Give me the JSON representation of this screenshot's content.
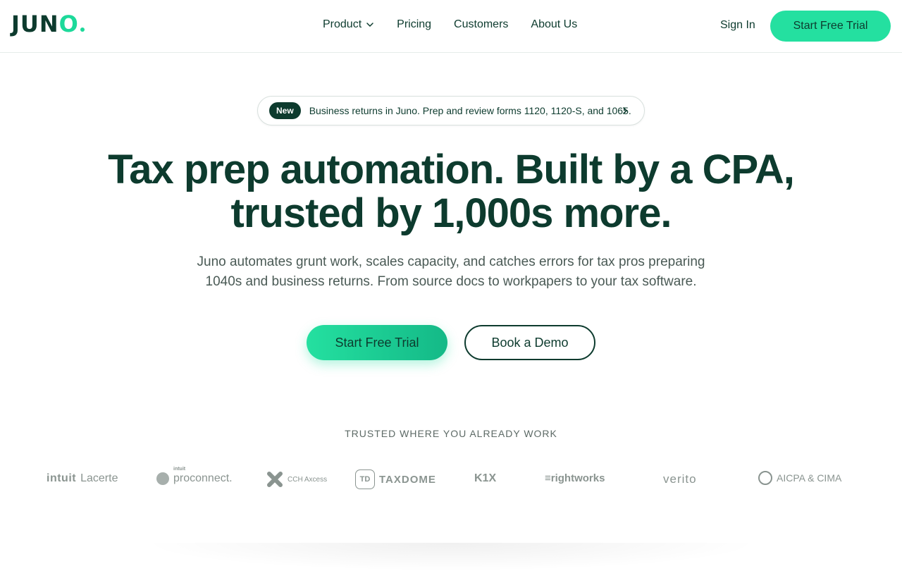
{
  "nav": {
    "logo": "JUNO",
    "links": [
      {
        "label": "Product",
        "has_dropdown": true
      },
      {
        "label": "Pricing"
      },
      {
        "label": "Customers"
      },
      {
        "label": "About Us"
      }
    ],
    "sign_in": "Sign In",
    "cta": "Start Free Trial"
  },
  "announcement": {
    "badge": "New",
    "text": "Business returns in Juno. Prep and review forms 1120, 1120-S, and 1065."
  },
  "hero": {
    "headline_line1": "Tax prep automation. Built by a CPA,",
    "headline_line2": "trusted by 1,000s more.",
    "subtitle_line1": "Juno automates grunt work, scales capacity, and catches errors for tax pros preparing",
    "subtitle_line2": "1040s and business returns. From source docs to workpapers to your tax software.",
    "primary_cta": "Start Free Trial",
    "secondary_cta": "Book a Demo"
  },
  "trust": {
    "heading": "TRUSTED WHERE YOU ALREADY WORK",
    "logos": [
      {
        "name": "intuit-lacerte",
        "text_a": "intuit",
        "text_b": "Lacerte"
      },
      {
        "name": "proconnect",
        "text_a": "intuit",
        "text_b": "proconnect."
      },
      {
        "name": "cch-axcess",
        "text_b": "CCH Axcess"
      },
      {
        "name": "taxdome",
        "text_a": "TD",
        "text_b": "TAXDOME"
      },
      {
        "name": "k1x",
        "text_b": "K1X"
      },
      {
        "name": "rightworks",
        "text_b": "≡rightworks"
      },
      {
        "name": "verito",
        "text_b": "verito"
      },
      {
        "name": "aicpa-cima",
        "text_b": "AICPA & CIMA"
      }
    ]
  },
  "colors": {
    "brand_dark": "#0d3b2e",
    "brand_accent": "#24e0a0",
    "muted_text": "#4a5a55",
    "logo_gray": "#8a9490"
  }
}
